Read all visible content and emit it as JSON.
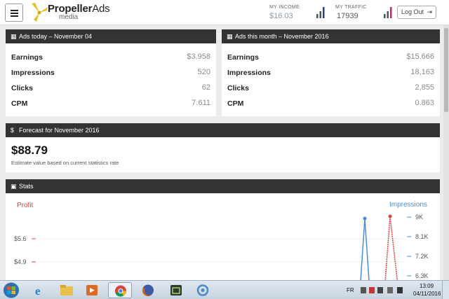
{
  "header": {
    "brand": "PropellerAds",
    "brand_part1": "Propeller",
    "brand_part2": "Ads",
    "brand_sub": "media",
    "income_label": "MY INCOME",
    "income_value": "$16.03",
    "traffic_label": "MY TRAFFIC",
    "traffic_value": "17939",
    "logout_label": "Log Out"
  },
  "today": {
    "title": "Ads today – November 04",
    "rows": [
      {
        "label": "Earnings",
        "value": "$3.958"
      },
      {
        "label": "Impressions",
        "value": "520"
      },
      {
        "label": "Clicks",
        "value": "62"
      },
      {
        "label": "CPM",
        "value": "7.611"
      }
    ]
  },
  "month": {
    "title": "Ads this month – November 2016",
    "rows": [
      {
        "label": "Earnings",
        "value": "$15.666"
      },
      {
        "label": "Impressions",
        "value": "18,163"
      },
      {
        "label": "Clicks",
        "value": "2,855"
      },
      {
        "label": "CPM",
        "value": "0.863"
      }
    ]
  },
  "forecast": {
    "title": "Forecast for November 2016",
    "amount": "$88.79",
    "note": "Estimate value based on current statistics rate"
  },
  "stats": {
    "title": "Stats",
    "left_axis_title": "Profit",
    "right_axis_title": "Impressions",
    "left_ticks": [
      "$5.6",
      "$4.9"
    ],
    "right_ticks": [
      "9K",
      "8.1K",
      "7.2K",
      "6.3K"
    ]
  },
  "taskbar": {
    "lang": "FR",
    "time": "13:09",
    "date": "04/11/2016"
  },
  "colors": {
    "panel_head": "#333333",
    "profit": "#e04040",
    "impressions": "#4a90d9",
    "value_gray": "#8a8a8a"
  }
}
